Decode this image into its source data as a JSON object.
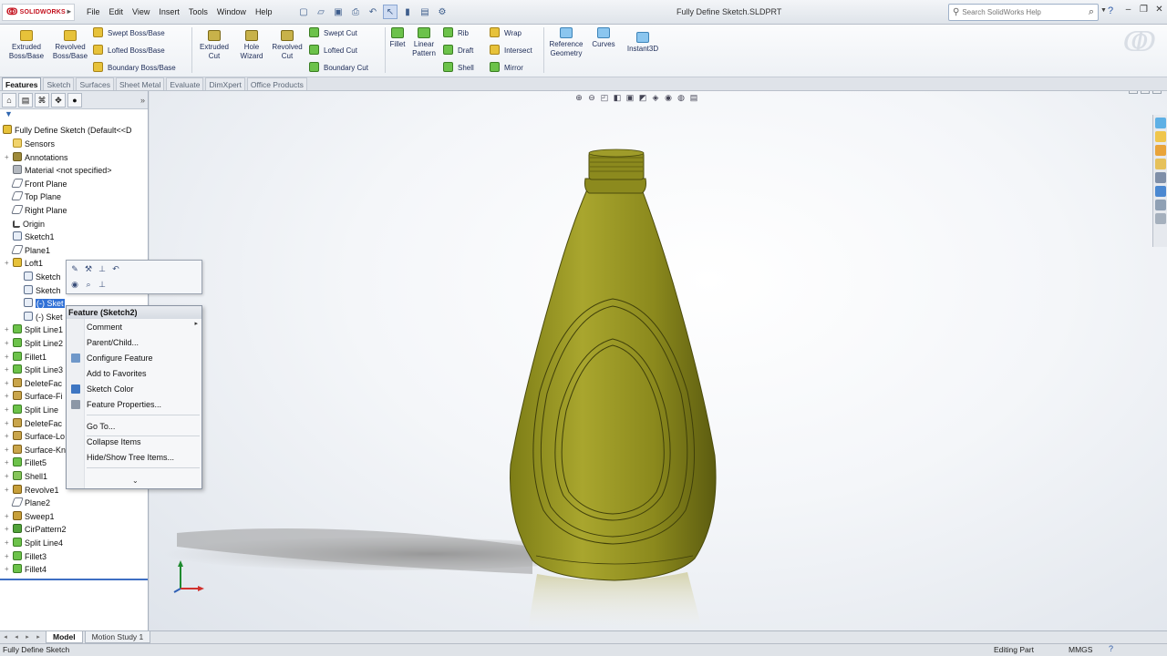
{
  "app": {
    "brand": "SOLIDWORKS",
    "document_title": "Fully Define Sketch.SLDPRT",
    "menus": [
      "File",
      "Edit",
      "View",
      "Insert",
      "Tools",
      "Window",
      "Help"
    ],
    "search_placeholder": "Search SolidWorks Help"
  },
  "ribbon": {
    "extruded_boss": "Extruded Boss/Base",
    "revolved_boss": "Revolved Boss/Base",
    "swept_boss": "Swept Boss/Base",
    "lofted_boss": "Lofted Boss/Base",
    "boundary_boss": "Boundary Boss/Base",
    "extruded_cut": "Extruded Cut",
    "hole_wizard": "Hole Wizard",
    "revolved_cut": "Revolved Cut",
    "swept_cut": "Swept Cut",
    "lofted_cut": "Lofted Cut",
    "boundary_cut": "Boundary Cut",
    "fillet": "Fillet",
    "linear_pattern": "Linear Pattern",
    "rib": "Rib",
    "draft": "Draft",
    "shell": "Shell",
    "wrap": "Wrap",
    "intersect": "Intersect",
    "mirror": "Mirror",
    "reference_geometry": "Reference Geometry",
    "curves": "Curves",
    "instant3d": "Instant3D"
  },
  "cm_tabs": [
    "Features",
    "Sketch",
    "Surfaces",
    "Sheet Metal",
    "Evaluate",
    "DimXpert",
    "Office Products"
  ],
  "tree": {
    "root": "Fully Define Sketch  (Default<<D",
    "items": [
      {
        "label": "Sensors"
      },
      {
        "label": "Annotations"
      },
      {
        "label": "Material <not specified>"
      },
      {
        "label": "Front Plane"
      },
      {
        "label": "Top Plane"
      },
      {
        "label": "Right Plane"
      },
      {
        "label": "Origin"
      },
      {
        "label": "Sketch1"
      },
      {
        "label": "Plane1"
      },
      {
        "label": "Loft1"
      },
      {
        "label": "Sketch"
      },
      {
        "label": "Sketch"
      },
      {
        "label": "(-) Sket"
      },
      {
        "label": "(-) Sket"
      },
      {
        "label": "Split Line1"
      },
      {
        "label": "Split Line2"
      },
      {
        "label": "Fillet1"
      },
      {
        "label": "Split Line3"
      },
      {
        "label": "DeleteFac"
      },
      {
        "label": "Surface-Fi"
      },
      {
        "label": "Split Line"
      },
      {
        "label": "DeleteFac"
      },
      {
        "label": "Surface-Lo"
      },
      {
        "label": "Surface-Kn"
      },
      {
        "label": "Fillet5"
      },
      {
        "label": "Shell1"
      },
      {
        "label": "Revolve1"
      },
      {
        "label": "Plane2"
      },
      {
        "label": "Sweep1"
      },
      {
        "label": "CirPattern2"
      },
      {
        "label": "Split Line4"
      },
      {
        "label": "Fillet3"
      },
      {
        "label": "Fillet4"
      }
    ]
  },
  "context_menu": {
    "header": "Feature (Sketch2)",
    "items": {
      "comment": "Comment",
      "parent_child": "Parent/Child...",
      "configure_feature": "Configure Feature",
      "add_to_favorites": "Add to Favorites",
      "sketch_color": "Sketch Color",
      "feature_properties": "Feature Properties...",
      "go_to": "Go To...",
      "collapse_items": "Collapse Items",
      "hide_show_tree": "Hide/Show Tree Items..."
    }
  },
  "bottom_tabs": [
    "Model",
    "Motion Study 1"
  ],
  "status": {
    "document": "Fully Define Sketch",
    "mode": "Editing Part",
    "units": "MMGS"
  },
  "colors": {
    "bottle": "#8f8f1e",
    "selection": "#3171d6"
  }
}
